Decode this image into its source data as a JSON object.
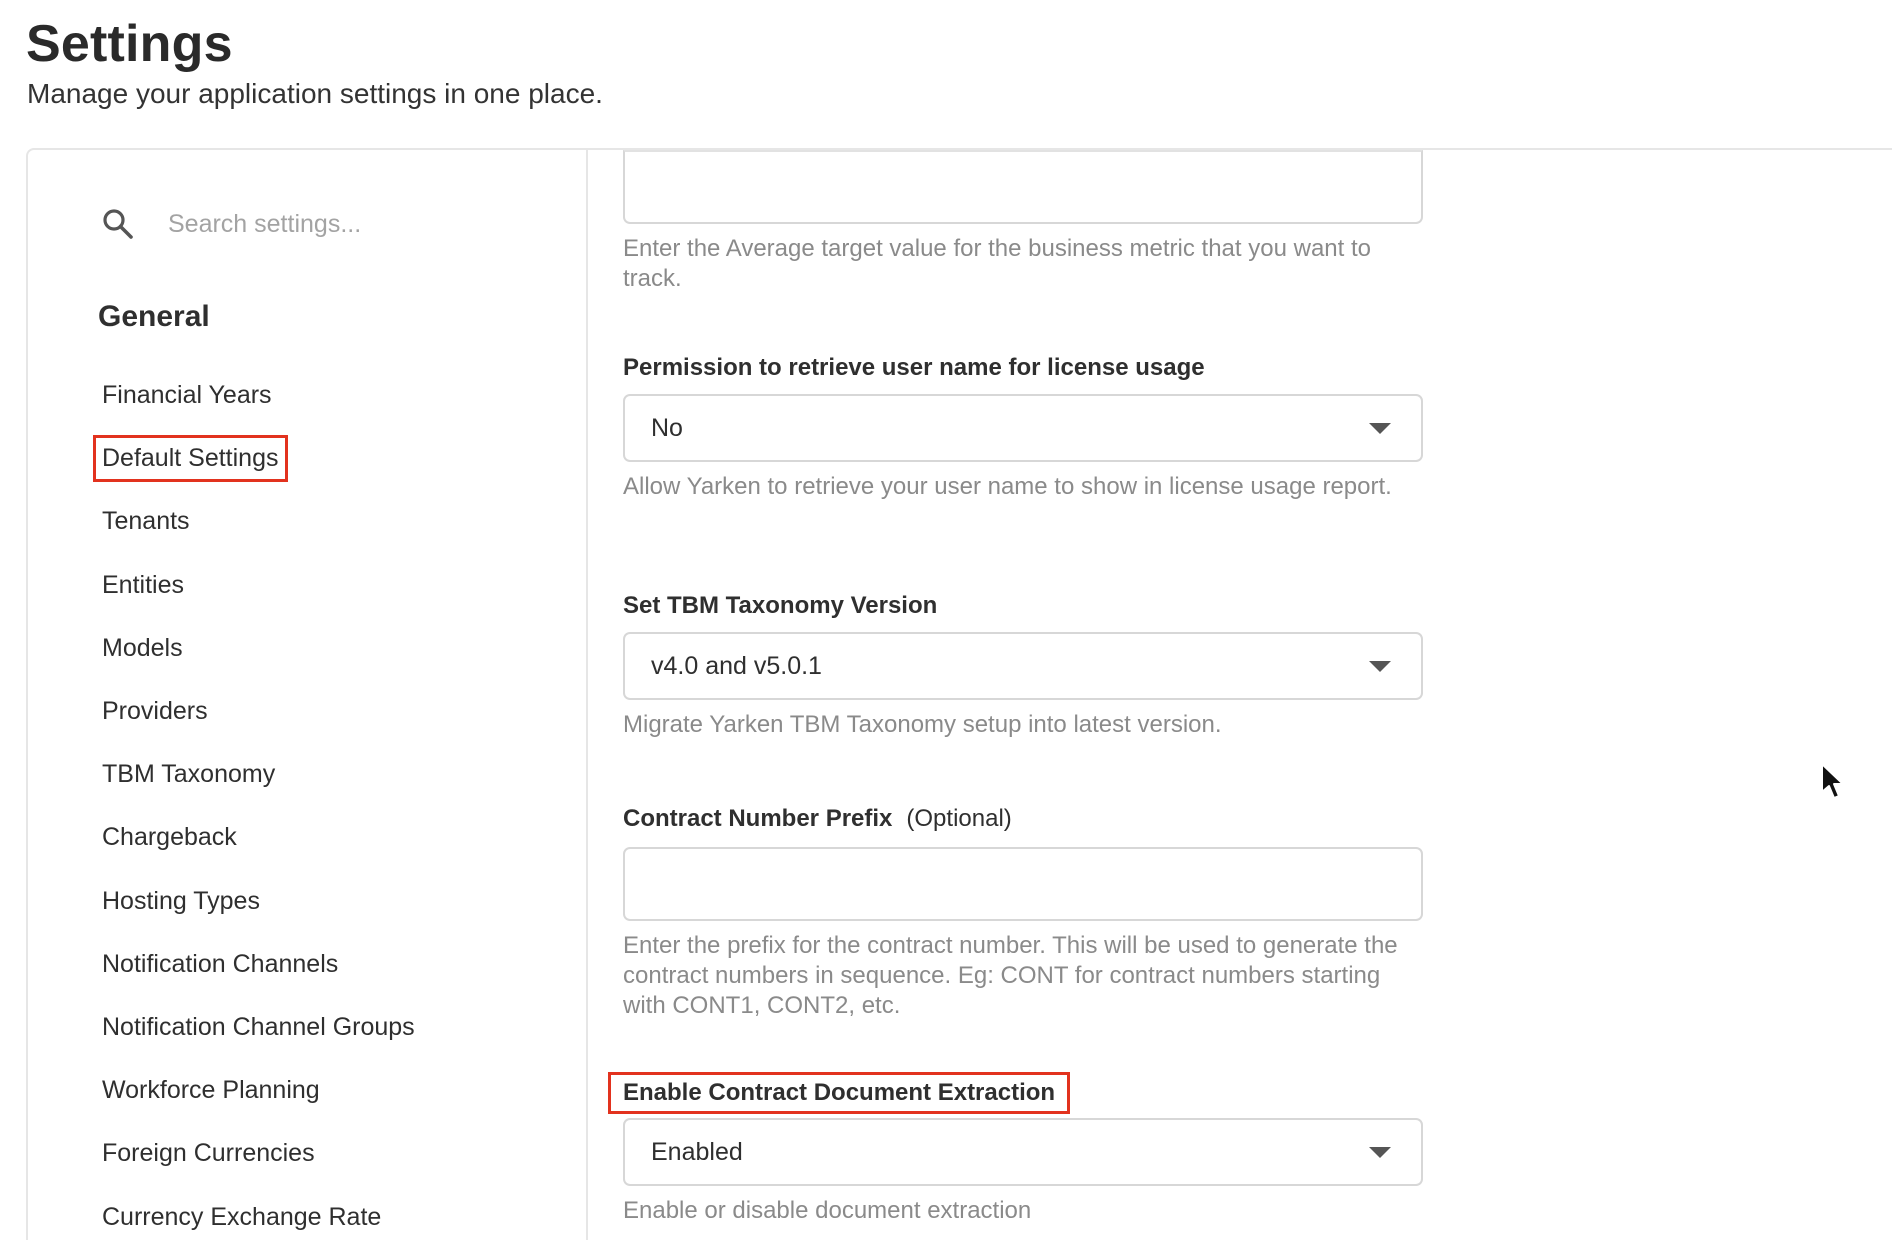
{
  "header": {
    "title": "Settings",
    "subtitle": "Manage your application settings in one place."
  },
  "sidebar": {
    "search": {
      "placeholder": "Search settings...",
      "value": "",
      "icon": "search-icon"
    },
    "section_heading": "General",
    "items": [
      {
        "label": "Financial Years"
      },
      {
        "label": "Default Settings",
        "highlighted": true
      },
      {
        "label": "Tenants"
      },
      {
        "label": "Entities"
      },
      {
        "label": "Models"
      },
      {
        "label": "Providers"
      },
      {
        "label": "TBM Taxonomy"
      },
      {
        "label": "Chargeback"
      },
      {
        "label": "Hosting Types"
      },
      {
        "label": "Notification Channels"
      },
      {
        "label": "Notification Channel Groups"
      },
      {
        "label": "Workforce Planning"
      },
      {
        "label": "Foreign Currencies"
      },
      {
        "label": "Currency Exchange Rate"
      }
    ]
  },
  "content": {
    "average_target": {
      "value": "",
      "help": "Enter the Average target value for the business metric that you want to track."
    },
    "license_permission": {
      "label": "Permission to retrieve user name for license usage",
      "selected": "No",
      "help": "Allow Yarken to retrieve your user name to show in license usage report."
    },
    "tbm_version": {
      "label": "Set TBM Taxonomy Version",
      "selected": "v4.0 and v5.0.1",
      "help": "Migrate Yarken TBM Taxonomy setup into latest version."
    },
    "contract_prefix": {
      "label": "Contract Number Prefix",
      "optional": "(Optional)",
      "value": "",
      "help": "Enter the prefix for the contract number. This will be used to generate the contract numbers in sequence. Eg: CONT for contract numbers starting with CONT1, CONT2, etc."
    },
    "doc_extraction": {
      "label": "Enable Contract Document Extraction",
      "selected": "Enabled",
      "help": "Enable or disable document extraction"
    }
  },
  "colors": {
    "highlight": "#e2321e",
    "border": "#d7d7d7",
    "help_text": "#8a8a8a"
  }
}
